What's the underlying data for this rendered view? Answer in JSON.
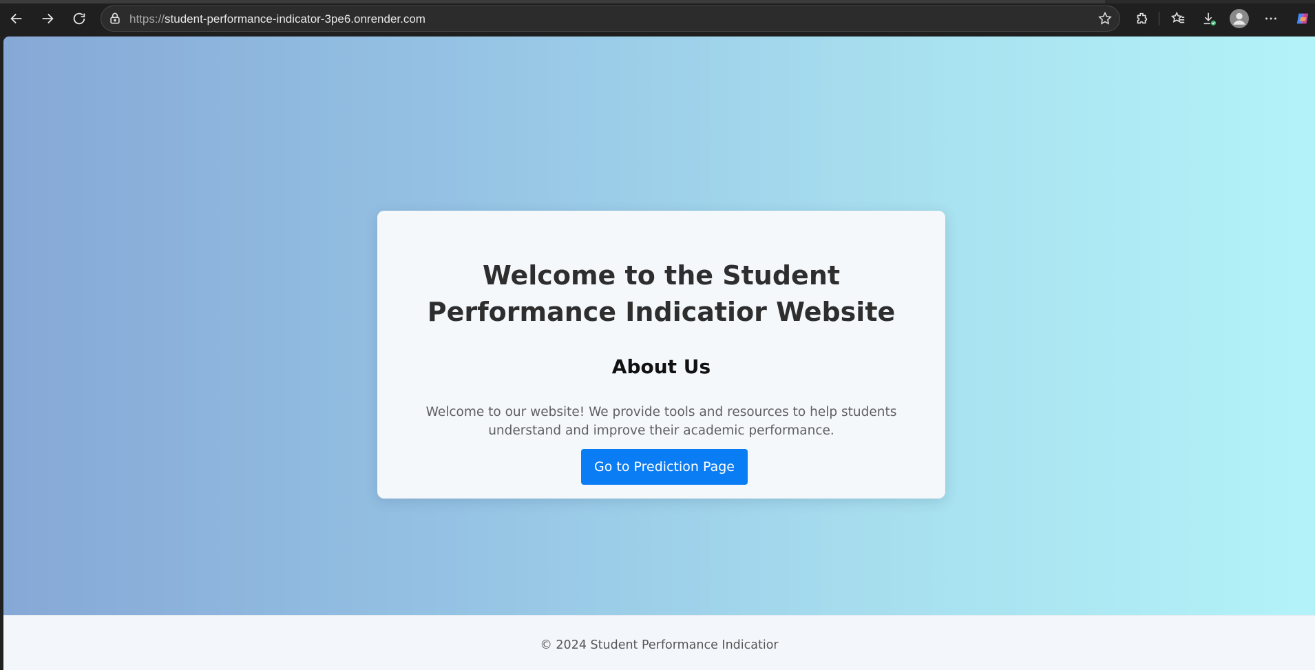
{
  "browser": {
    "url_prefix": "https://",
    "url_host": "student-performance-indicator-3pe6.onrender.com"
  },
  "page": {
    "title": "Welcome to the Student Performance Indicatior Website",
    "about_heading": "About Us",
    "about_text": "Welcome to our website! We provide tools and resources to help students understand and improve their academic performance.",
    "cta_label": "Go to Prediction Page",
    "footer": "© 2024 Student Performance Indicatior"
  },
  "colors": {
    "button": "#0a7cf4",
    "gradient_start": "#86a8d6",
    "gradient_end": "#b3f3f8"
  },
  "icons": [
    "back-arrow-icon",
    "forward-arrow-icon",
    "refresh-icon",
    "lock-icon",
    "favorite-star-icon",
    "extensions-icon",
    "favorites-icon",
    "downloads-icon",
    "profile-icon",
    "more-icon",
    "copilot-icon"
  ]
}
